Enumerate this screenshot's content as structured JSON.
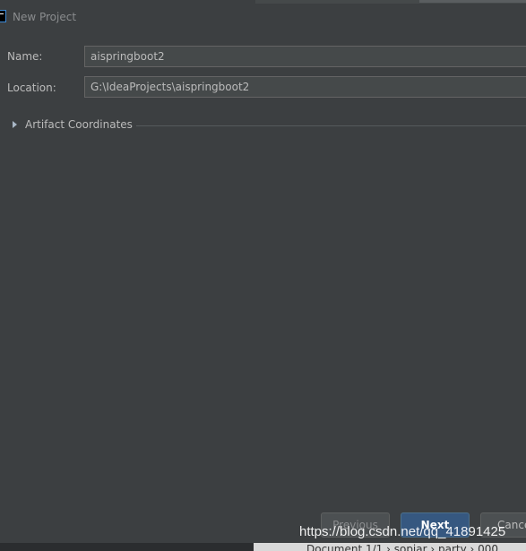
{
  "dialog": {
    "title": "New Project"
  },
  "form": {
    "name_label": "Name:",
    "name_value": "aispringboot2",
    "location_label": "Location:",
    "location_value": "G:\\IdeaProjects\\aispringboot2"
  },
  "artifact": {
    "label": "Artifact Coordinates",
    "expanded": false
  },
  "buttons": {
    "previous": "Previous",
    "next": "Next",
    "cancel": "Cance"
  },
  "statusbar": {
    "text": "Document 1/1  ›  sopiar  ›  party  ›  000"
  },
  "watermark": {
    "text": "https://blog.csdn.net/qq_41891425"
  },
  "icons": {
    "app": "intellij-idea-icon",
    "expand": "triangle-right-icon"
  },
  "colors": {
    "background": "#3c3f41",
    "field_background": "#45494a",
    "primary_button": "#365880",
    "text": "#bbbbbb"
  }
}
